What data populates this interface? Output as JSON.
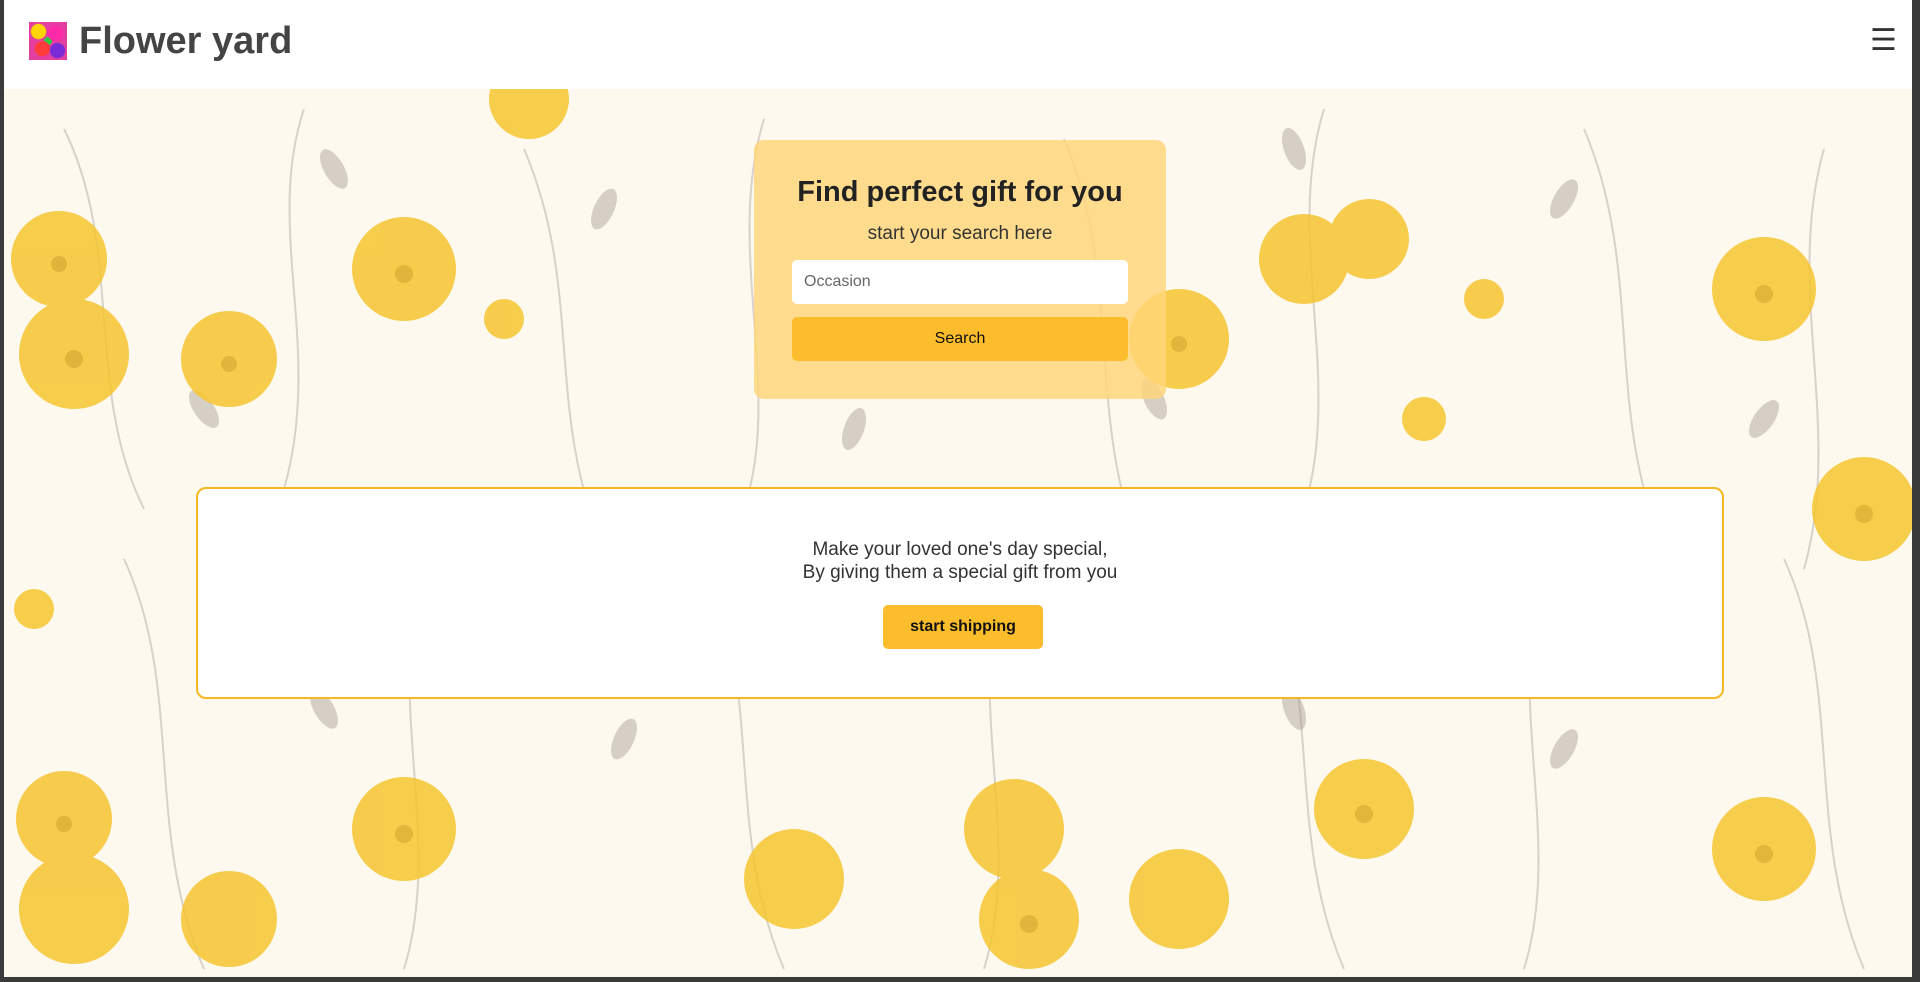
{
  "header": {
    "brand_title": "Flower yard",
    "menu_icon": "☰"
  },
  "search": {
    "title": "Find perfect gift for you",
    "subtitle": "start your search here",
    "placeholder": "Occasion",
    "value": "",
    "button_label": "Search"
  },
  "promo": {
    "line1": "Make your loved one's day special,",
    "line2": "By giving them a special gift from you",
    "button_label": "start shipping"
  },
  "colors": {
    "accent": "#fbbd2c",
    "card_bg": "#ffd678",
    "border": "#f5b820",
    "page_bg": "#fdf9ee"
  }
}
